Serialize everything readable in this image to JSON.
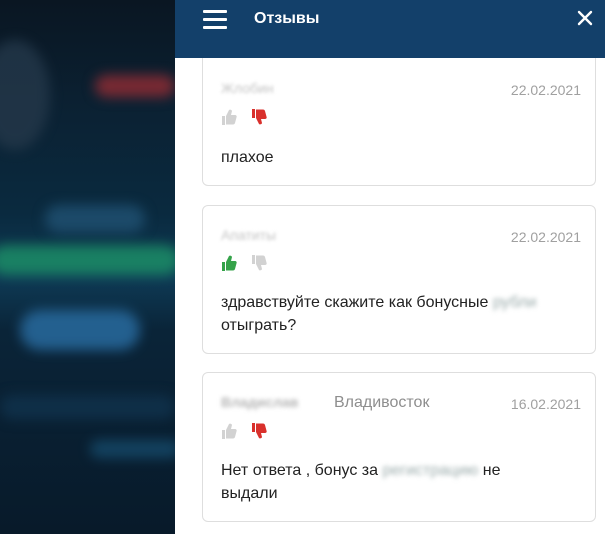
{
  "header": {
    "title": "Отзывы",
    "menu_icon": "hamburger-menu-icon",
    "close_icon": "close-icon"
  },
  "colors": {
    "header_bg": "#13406a",
    "like_active": "#35a34a",
    "dislike_active": "#d9302c",
    "inactive_icon": "#cfcfcf"
  },
  "reviews": [
    {
      "author": "Жлобин",
      "date": "22.02.2021",
      "vote": "dislike",
      "text": "плахое"
    },
    {
      "author": "Апатиты",
      "date": "22.02.2021",
      "vote": "like",
      "text_visible": "здравствуйте скажите как бонусные",
      "text_blurred": "рубли",
      "text_line2": "отыграть?"
    },
    {
      "author": "Владислав",
      "city": "Владивосток",
      "date": "16.02.2021",
      "vote": "dislike",
      "text_part1": "Нет ответа , бонус за ",
      "text_blurred": "регистрацию",
      "text_part2": " не",
      "text_line2": "выдали"
    }
  ]
}
